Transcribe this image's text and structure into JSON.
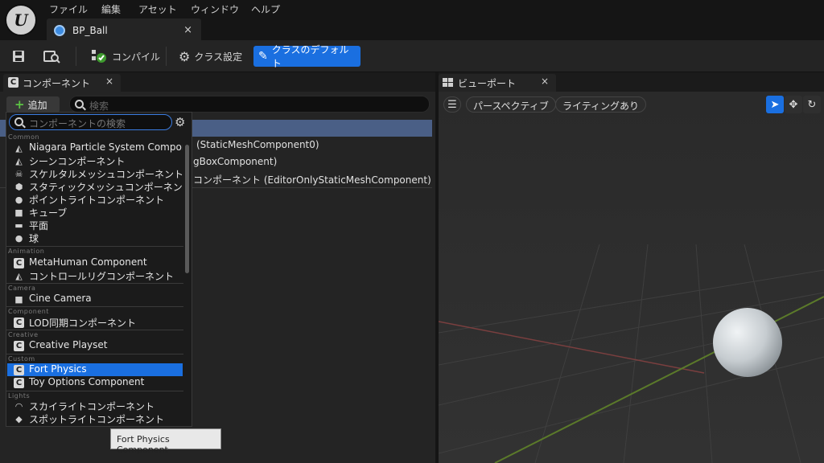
{
  "menu": [
    "ファイル",
    "編集",
    "アセット",
    "ウィンドウ",
    "ヘルプ"
  ],
  "document_tab": {
    "title": "BP_Ball",
    "close": "×"
  },
  "toolbar": {
    "compile": "コンパイル",
    "class_settings": "クラス設定",
    "class_defaults": "クラスのデフォルト"
  },
  "components_panel": {
    "tab_title": "コンポーネント",
    "close": "×",
    "add_label": "追加",
    "search_placeholder": "検索",
    "tree_rows": [
      "",
      "(StaticMeshComponent0)",
      "gBoxComponent)",
      "コンポーネント (EditorOnlyStaticMeshComponent)"
    ]
  },
  "add_menu": {
    "search_placeholder": "コンポーネントの検索",
    "categories": {
      "common": "Common",
      "animation": "Animation",
      "camera": "Camera",
      "component": "Component",
      "creative": "Creative",
      "custom": "Custom",
      "lights": "Lights"
    },
    "items": [
      "Niagara Particle System Component",
      "シーンコンポーネント",
      "スケルタルメッシュコンポーネント",
      "スタティックメッシュコンポーネント",
      "ポイントライトコンポーネント",
      "キューブ",
      "平面",
      "球",
      "MetaHuman Component",
      "コントロールリグコンポーネント",
      "Cine Camera",
      "LOD同期コンポーネント",
      "Creative Playset",
      "Fort Physics",
      "Toy Options Component",
      "スカイライトコンポーネント",
      "スポットライトコンポーネント"
    ],
    "selected": "Fort Physics"
  },
  "tooltip": "Fort Physics Component",
  "viewport": {
    "tab_title": "ビューポート",
    "close": "×",
    "perspective": "パースペクティブ",
    "lighting": "ライティングあり"
  },
  "colors": {
    "accent": "#1a6fe0",
    "add_green": "#5cc344",
    "panel_bg": "#242424"
  }
}
